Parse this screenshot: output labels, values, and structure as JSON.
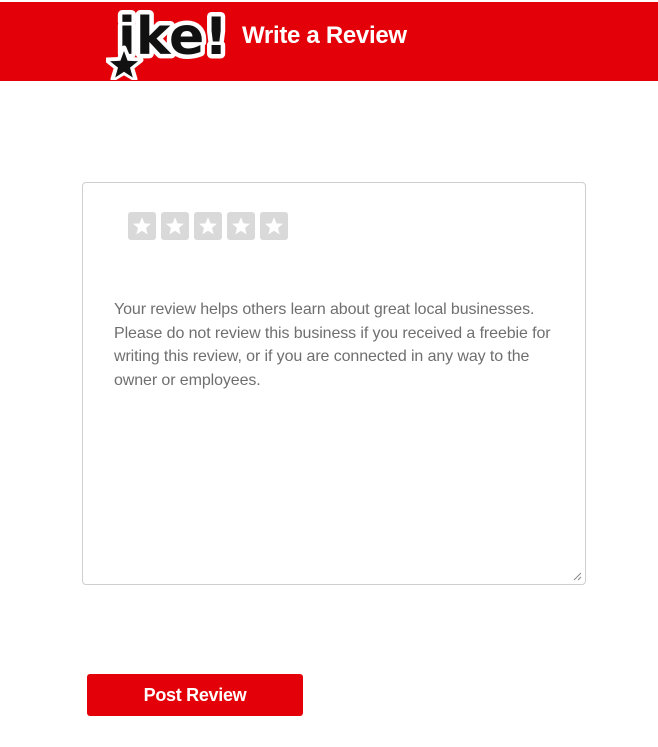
{
  "header": {
    "logo_text": "ike!",
    "title": "Write a Review",
    "brand_color": "#e30008"
  },
  "review": {
    "rating": 0,
    "max_rating": 5,
    "star_icon": "star-icon",
    "placeholder": "Your review helps others learn about great local businesses. Please do not review this business if you received a freebie for writing this review, or if you are connected in any way to the owner or employees."
  },
  "actions": {
    "post_label": "Post Review"
  }
}
